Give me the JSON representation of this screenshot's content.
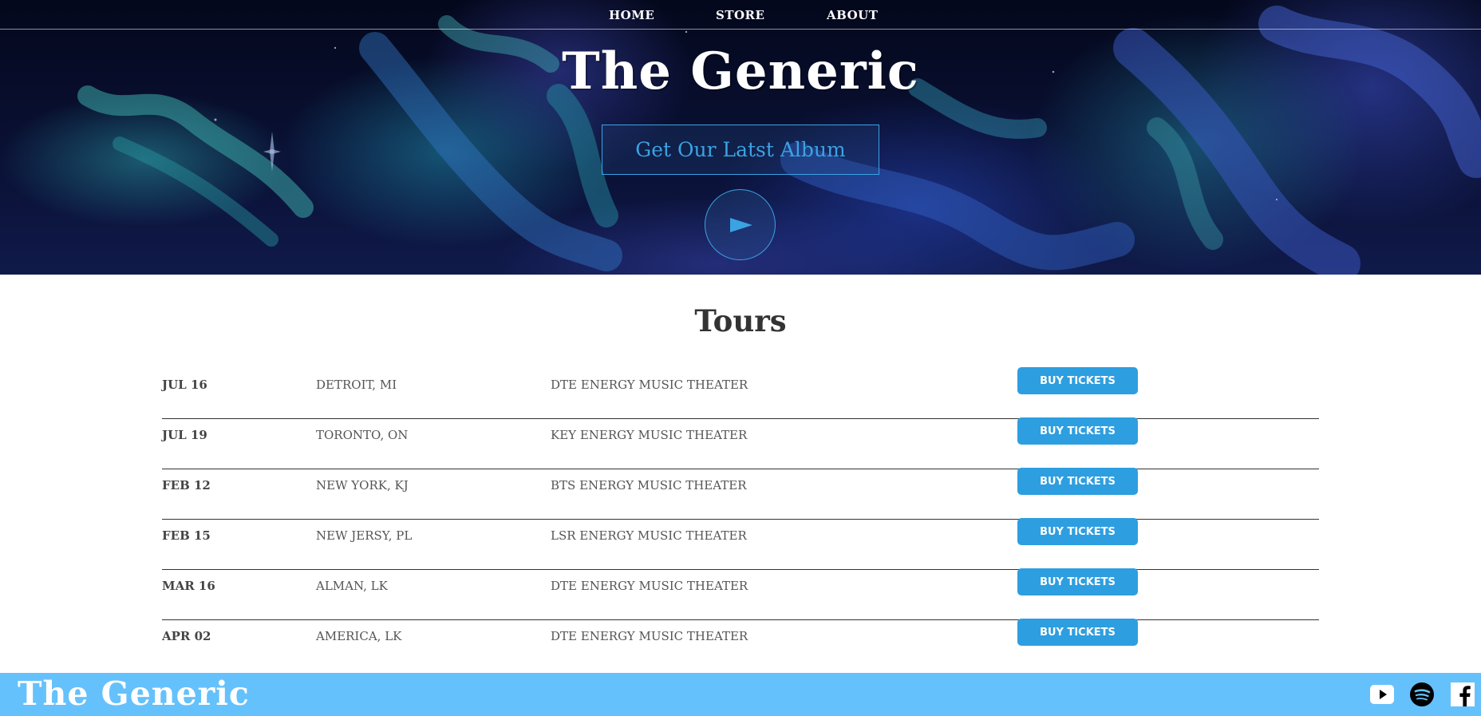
{
  "nav": {
    "home": "HOME",
    "store": "STORE",
    "about": "ABOUT"
  },
  "hero": {
    "title": "The Generic",
    "album_button": "Get Our Latst Album",
    "play_icon": "play-icon"
  },
  "tours": {
    "title": "Tours",
    "rows": [
      {
        "date": "JUL 16",
        "city": "DETROIT, MI",
        "venue": "DTE ENERGY MUSIC THEATER",
        "button": "BUY TICKETS"
      },
      {
        "date": "JUL 19",
        "city": "TORONTO, ON",
        "venue": "KEY ENERGY MUSIC THEATER",
        "button": "BUY TICKETS"
      },
      {
        "date": "FEB 12",
        "city": "NEW YORK, KJ",
        "venue": "BTS ENERGY MUSIC THEATER",
        "button": "BUY TICKETS"
      },
      {
        "date": "FEB 15",
        "city": "NEW JERSY, PL",
        "venue": "LSR ENERGY MUSIC THEATER",
        "button": "BUY TICKETS"
      },
      {
        "date": "MAR 16",
        "city": "ALMAN, LK",
        "venue": "DTE ENERGY MUSIC THEATER",
        "button": "BUY TICKETS"
      },
      {
        "date": "APR 02",
        "city": "AMERICA, LK",
        "venue": "DTE ENERGY MUSIC THEATER",
        "button": "BUY TICKETS"
      }
    ]
  },
  "footer": {
    "title": "The Generic",
    "social": [
      "youtube-icon",
      "spotify-icon",
      "facebook-icon"
    ]
  },
  "colors": {
    "accent": "#2d9ee0",
    "footer_bg": "#65c1fb",
    "hero_text": "#3aa3e3",
    "heading_text": "#333333"
  }
}
